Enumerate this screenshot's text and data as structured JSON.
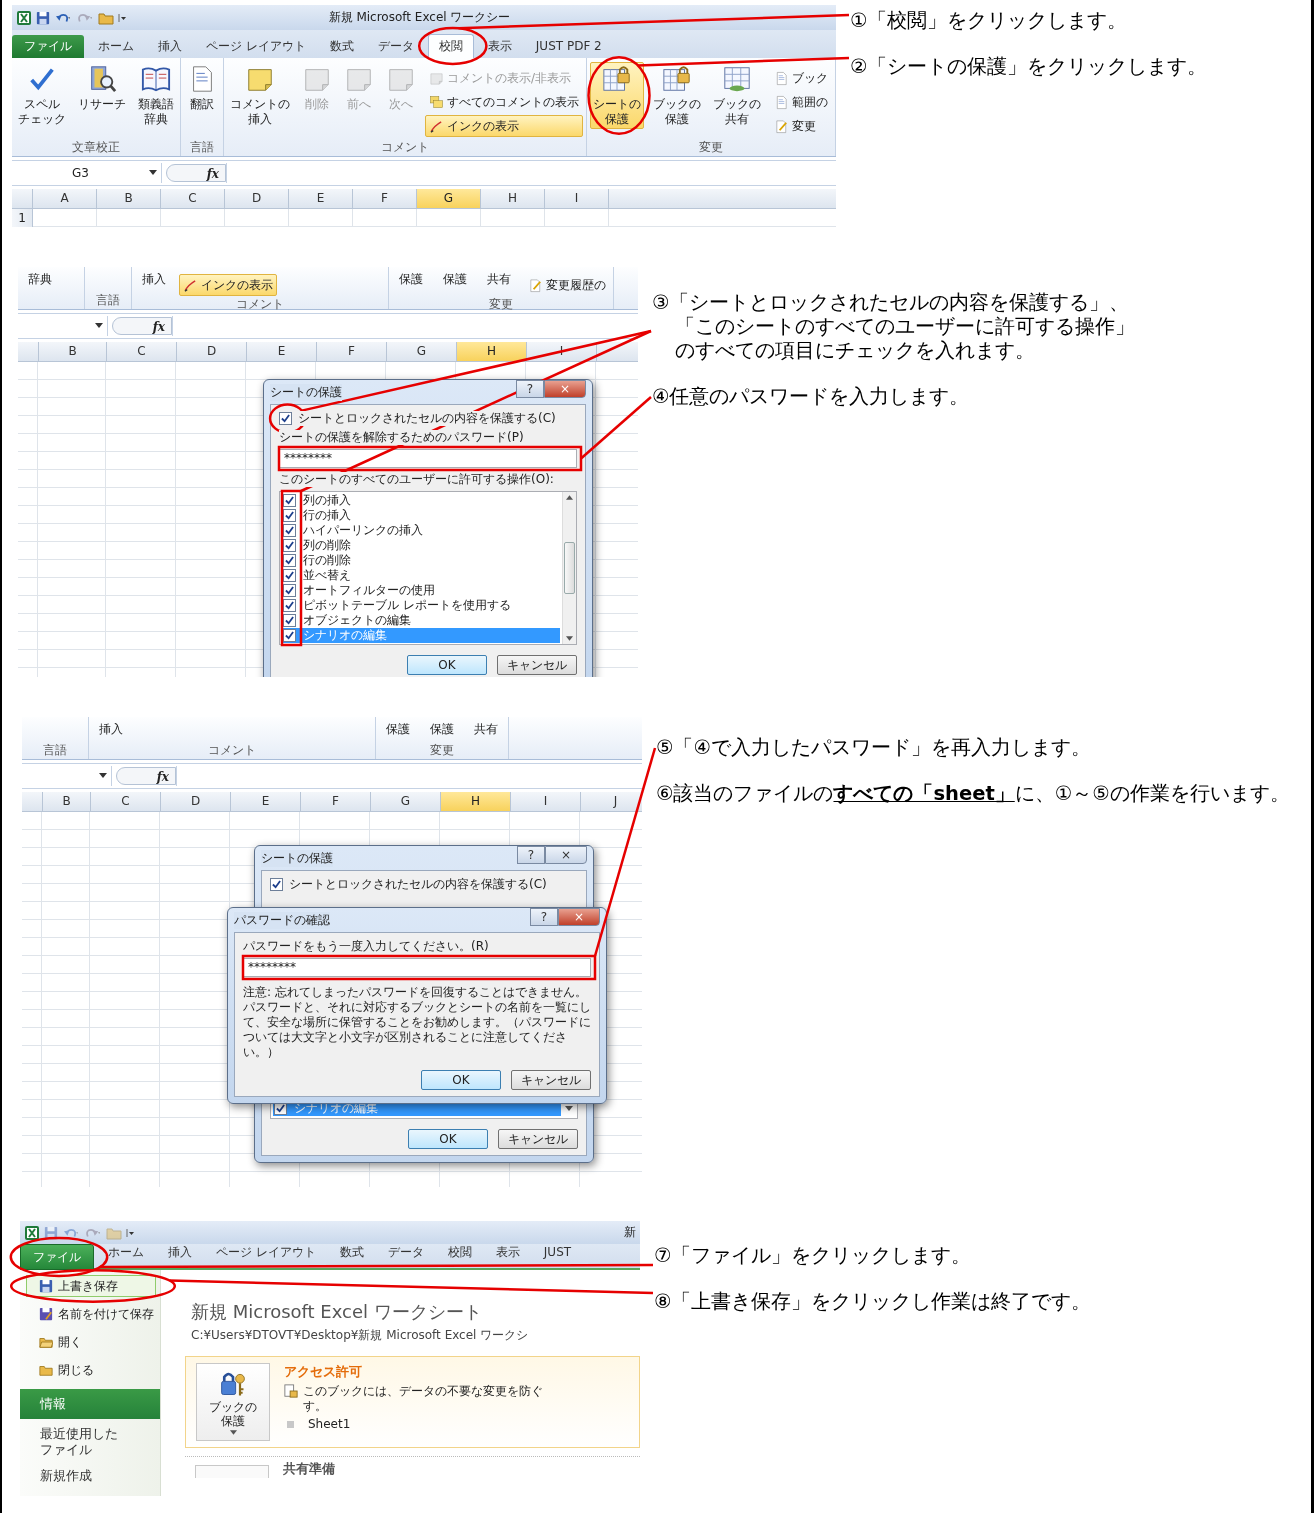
{
  "sections": [
    {
      "screenshot": {
        "kind": "ribbon_view",
        "title": "新規 Microsoft Excel ワークシー",
        "tabs": [
          {
            "label": "ファイル",
            "kind": "file",
            "selected": false
          },
          {
            "label": "ホーム",
            "kind": "tab",
            "selected": false
          },
          {
            "label": "挿入",
            "kind": "tab",
            "selected": false
          },
          {
            "label": "ページ レイアウト",
            "kind": "tab",
            "selected": false
          },
          {
            "label": "数式",
            "kind": "tab",
            "selected": false
          },
          {
            "label": "データ",
            "kind": "tab",
            "selected": false
          },
          {
            "label": "校閲",
            "kind": "tab",
            "selected": true
          },
          {
            "label": "表示",
            "kind": "tab",
            "selected": false
          },
          {
            "label": "JUST PDF 2",
            "kind": "tab",
            "selected": false
          }
        ],
        "groups": [
          {
            "label": "文章校正",
            "items": [
              {
                "kind": "large",
                "lines": [
                  "スペル",
                  "チェック"
                ],
                "disabled": false,
                "highlighted": false
              },
              {
                "kind": "large",
                "lines": [
                  "リサーチ"
                ],
                "disabled": false,
                "highlighted": false
              },
              {
                "kind": "large",
                "lines": [
                  "類義語",
                  "辞典"
                ],
                "disabled": false,
                "highlighted": false
              }
            ]
          },
          {
            "label": "言語",
            "items": [
              {
                "kind": "large",
                "lines": [
                  "翻訳"
                ],
                "disabled": false,
                "highlighted": false
              }
            ]
          },
          {
            "label": "コメント",
            "items": [
              {
                "kind": "large",
                "lines": [
                  "コメントの",
                  "挿入"
                ],
                "disabled": false,
                "highlighted": false
              },
              {
                "kind": "large",
                "lines": [
                  "削除"
                ],
                "disabled": true,
                "highlighted": false
              },
              {
                "kind": "large",
                "lines": [
                  "前へ"
                ],
                "disabled": true,
                "highlighted": false
              },
              {
                "kind": "large",
                "lines": [
                  "次へ"
                ],
                "disabled": true,
                "highlighted": false
              },
              {
                "kind": "small",
                "label": "コメントの表示/非表示",
                "disabled": true,
                "highlighted": false
              },
              {
                "kind": "small",
                "label": "すべてのコメントの表示",
                "disabled": false,
                "highlighted": false
              },
              {
                "kind": "small",
                "label": "インクの表示",
                "disabled": false,
                "highlighted": true
              }
            ]
          },
          {
            "label": "変更",
            "items": [
              {
                "kind": "large",
                "lines": [
                  "シートの",
                  "保護"
                ],
                "disabled": false,
                "highlighted": true
              },
              {
                "kind": "large",
                "lines": [
                  "ブックの",
                  "保護"
                ],
                "disabled": false,
                "highlighted": false
              },
              {
                "kind": "large",
                "lines": [
                  "ブックの",
                  "共有"
                ],
                "disabled": false,
                "highlighted": false
              },
              {
                "kind": "small",
                "label": "ブック",
                "disabled": false,
                "highlighted": false
              },
              {
                "kind": "small",
                "label": "範囲の",
                "disabled": false,
                "highlighted": false
              },
              {
                "kind": "small",
                "label": "変更",
                "disabled": false,
                "highlighted": false
              }
            ]
          }
        ],
        "name_box": "G3",
        "function_label": "fx",
        "columns": [
          {
            "label": "A",
            "selected": false
          },
          {
            "label": "B",
            "selected": false
          },
          {
            "label": "C",
            "selected": false
          },
          {
            "label": "D",
            "selected": false
          },
          {
            "label": "E",
            "selected": false
          },
          {
            "label": "F",
            "selected": false
          },
          {
            "label": "G",
            "selected": true
          },
          {
            "label": "H",
            "selected": false
          },
          {
            "label": "I",
            "selected": false
          }
        ],
        "rows": [
          "1"
        ]
      },
      "steps": [
        {
          "kind": "step",
          "text": "①「校閲」をクリックします。"
        },
        {
          "kind": "step",
          "text": "②「シートの保護」をクリックします。"
        }
      ]
    },
    {
      "screenshot": {
        "kind": "protect_dialog_view",
        "groups": [
          {
            "items": [
              {
                "kind": "text",
                "label": "辞典",
                "disabled": false,
                "highlighted": false
              }
            ]
          },
          {
            "label": "言語"
          },
          {
            "label": "コメント",
            "items": [
              {
                "kind": "text",
                "label": "挿入",
                "disabled": false,
                "highlighted": false
              },
              {
                "kind": "small",
                "label": "インクの表示",
                "disabled": false,
                "highlighted": true
              }
            ]
          },
          {
            "label": "変更",
            "items": [
              {
                "kind": "text",
                "label": "保護",
                "disabled": false,
                "highlighted": false
              },
              {
                "kind": "text",
                "label": "保護",
                "disabled": false,
                "highlighted": false
              },
              {
                "kind": "text",
                "label": "共有",
                "disabled": false,
                "highlighted": false
              },
              {
                "kind": "small",
                "label": "変更履歴の",
                "disabled": false,
                "highlighted": false
              }
            ]
          }
        ],
        "function_label": "fx",
        "columns": [
          {
            "label": "B",
            "selected": false
          },
          {
            "label": "C",
            "selected": false
          },
          {
            "label": "D",
            "selected": false
          },
          {
            "label": "E",
            "selected": false
          },
          {
            "label": "F",
            "selected": false
          },
          {
            "label": "G",
            "selected": false
          },
          {
            "label": "H",
            "selected": true
          },
          {
            "label": "I",
            "selected": false
          }
        ],
        "dialog": {
          "title": "シートの保護",
          "title_buttons": [
            "?",
            "×"
          ],
          "protect_checkbox": {
            "label": "シートとロックされたセルの内容を保護する(C)",
            "checked": true
          },
          "password_label": "シートの保護を解除するためのパスワード(P)",
          "password": "********",
          "permissions_label": "このシートのすべてのユーザーに許可する操作(O):",
          "permissions": [
            {
              "label": "列の挿入",
              "checked": true,
              "selected": false
            },
            {
              "label": "行の挿入",
              "checked": true,
              "selected": false
            },
            {
              "label": "ハイパーリンクの挿入",
              "checked": true,
              "selected": false
            },
            {
              "label": "列の削除",
              "checked": true,
              "selected": false
            },
            {
              "label": "行の削除",
              "checked": true,
              "selected": false
            },
            {
              "label": "並べ替え",
              "checked": true,
              "selected": false
            },
            {
              "label": "オートフィルターの使用",
              "checked": true,
              "selected": false
            },
            {
              "label": "ピボットテーブル レポートを使用する",
              "checked": true,
              "selected": false
            },
            {
              "label": "オブジェクトの編集",
              "checked": true,
              "selected": false
            },
            {
              "label": "シナリオの編集",
              "checked": true,
              "selected": true
            }
          ],
          "buttons": [
            "OK",
            "キャンセル"
          ]
        }
      },
      "steps": [
        {
          "kind": "step",
          "text": "③「シートとロックされたセルの内容を保護する」、"
        },
        {
          "kind": "continuation",
          "text": "「このシートのすべてのユーザーに許可する操作」"
        },
        {
          "kind": "continuation",
          "text": "のすべての項目にチェックを入れます。"
        },
        {
          "kind": "step",
          "text": "④任意のパスワードを入力します。"
        }
      ]
    },
    {
      "screenshot": {
        "kind": "confirm_dialog_view",
        "groups": [
          {
            "label": "言語"
          },
          {
            "label": "コメント",
            "items": [
              {
                "kind": "text",
                "label": "挿入",
                "disabled": false,
                "highlighted": false
              }
            ]
          },
          {
            "label": "変更",
            "items": [
              {
                "kind": "text",
                "label": "保護",
                "disabled": false,
                "highlighted": false
              },
              {
                "kind": "text",
                "label": "保護",
                "disabled": false,
                "highlighted": false
              },
              {
                "kind": "text",
                "label": "共有",
                "disabled": false,
                "highlighted": false
              }
            ]
          }
        ],
        "function_label": "fx",
        "columns": [
          {
            "label": "B",
            "selected": false
          },
          {
            "label": "C",
            "selected": false
          },
          {
            "label": "D",
            "selected": false
          },
          {
            "label": "E",
            "selected": false
          },
          {
            "label": "F",
            "selected": false
          },
          {
            "label": "G",
            "selected": false
          },
          {
            "label": "H",
            "selected": true
          },
          {
            "label": "I",
            "selected": false
          },
          {
            "label": "J",
            "selected": false
          }
        ],
        "back_dialog": {
          "title": "シートの保護",
          "title_buttons": [
            "?",
            "×"
          ],
          "protect_checkbox": {
            "label": "シートとロックされたセルの内容を保護する(C)",
            "checked": true
          },
          "last_permission": {
            "label": "シナリオの編集",
            "checked": true,
            "selected": true
          },
          "buttons": [
            "OK",
            "キャンセル"
          ]
        },
        "dialog": {
          "title": "パスワードの確認",
          "title_buttons": [
            "?",
            "×"
          ],
          "prompt": "パスワードをもう一度入力してください。(R)",
          "password": "********",
          "note": "注意: 忘れてしまったパスワードを回復することはできません。パスワードと、それに対応するブックとシートの名前を一覧にして、安全な場所に保管することをお勧めします。（パスワードについては大文字と小文字が区別されることに注意してください。）",
          "buttons": [
            "OK",
            "キャンセル"
          ]
        }
      },
      "steps": [
        {
          "kind": "step",
          "text": "⑤「④で入力したパスワード」を再入力します。"
        },
        {
          "kind": "step",
          "text": "⑥該当のファイルの**すべての「sheet」**に、①～⑤の作業を行います。"
        }
      ]
    },
    {
      "screenshot": {
        "kind": "backstage_view",
        "title": "新",
        "tabs": [
          {
            "label": "ファイル",
            "kind": "file",
            "selected": true
          },
          {
            "label": "ホーム",
            "kind": "tab",
            "selected": false
          },
          {
            "label": "挿入",
            "kind": "tab",
            "selected": false
          },
          {
            "label": "ページ レイアウト",
            "kind": "tab",
            "selected": false
          },
          {
            "label": "数式",
            "kind": "tab",
            "selected": false
          },
          {
            "label": "データ",
            "kind": "tab",
            "selected": false
          },
          {
            "label": "校閲",
            "kind": "tab",
            "selected": false
          },
          {
            "label": "表示",
            "kind": "tab",
            "selected": false
          },
          {
            "label": "JUST",
            "kind": "tab",
            "selected": false
          }
        ],
        "menu": [
          {
            "lines": [
              "上書き保存"
            ],
            "kind": "command",
            "selected": false,
            "highlighted": true
          },
          {
            "lines": [
              "名前を付けて保存"
            ],
            "kind": "command",
            "selected": false,
            "highlighted": false
          },
          {
            "lines": [
              "開く"
            ],
            "kind": "command",
            "selected": false,
            "highlighted": false
          },
          {
            "lines": [
              "閉じる"
            ],
            "kind": "command",
            "selected": false,
            "highlighted": false
          },
          {
            "lines": [
              "情報"
            ],
            "kind": "page",
            "selected": true,
            "highlighted": false
          },
          {
            "lines": [
              "最近使用した",
              "ファイル"
            ],
            "kind": "page",
            "selected": false,
            "highlighted": false
          },
          {
            "lines": [
              "新規作成"
            ],
            "kind": "page",
            "selected": false,
            "highlighted": false
          }
        ],
        "doc_title": "新規 Microsoft Excel ワークシート",
        "path": "C:¥Users¥DTOVT¥Desktop¥新規 Microsoft Excel ワークシ",
        "permissions": {
          "button_lines": [
            "ブックの",
            "保護"
          ],
          "heading": "アクセス許可",
          "description_lines": [
            "このブックには、データの不要な変更を防ぐ",
            "す。"
          ],
          "sheets": [
            "Sheet1"
          ]
        },
        "next_heading": "共有準備"
      },
      "steps": [
        {
          "kind": "step",
          "text": "⑦「ファイル」をクリックします。"
        },
        {
          "kind": "step",
          "text": "⑧「上書き保存」をクリックし作業は終了です。"
        }
      ]
    }
  ]
}
